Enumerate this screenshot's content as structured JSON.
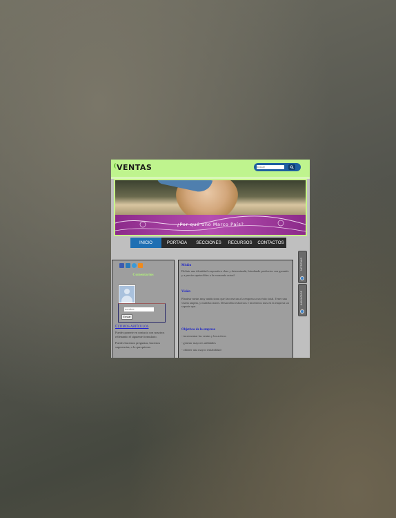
{
  "header": {
    "logo": "VENTAS",
    "search": {
      "placeholder": "buscar"
    }
  },
  "banner": {
    "caption": "¿Por qué uno Marco País?"
  },
  "nav": {
    "items": [
      "INICIO",
      "PORTADA",
      "SECCIONES",
      "RECURSOS",
      "CONTACTOS"
    ],
    "active_index": 0
  },
  "sidebar": {
    "social_icons": [
      "facebook-icon",
      "linkedin-icon",
      "twitter-icon",
      "rss-icon"
    ],
    "title": "Comentarios",
    "form": {
      "input_value": "nombre",
      "button_label": "Enviar"
    },
    "link": "ÚLTIMOS ARTÍCULOS",
    "text1": "Puedes ponerte en contacto con nosotros rellenando el siguiente formulario.",
    "text2": "Puedes hacernos preguntas, hacernos sugerencias, o lo que quieras."
  },
  "content": {
    "mision_title": "Misión",
    "mision_text": "Definir una identidad corporativa clara y determinada, brindando productos con garantía y a precios apetecibles a la economía actual.",
    "vision_title": "Visión",
    "vision_text": "Plantear metas muy ambiciosas que favorezcan a la empresa a un éxito total. Tener una visión amplia, y multifacciones. Desarrollar esfuerzos e incentivos más en la empresa un soporte que.",
    "objetivos_title": "Objetivos de la empresa",
    "objetivos": [
      "- incrementar las ventas y los activos",
      "- generar mayores utilidades",
      "- obtener una mayor rentabilidad"
    ]
  },
  "side_tabs": [
    {
      "label": "NOTICIAS",
      "icon": "arrow-icon"
    },
    {
      "label": "ANUNCIOS",
      "icon": "arrow-icon"
    }
  ],
  "colors": {
    "header_green": "#bff48e",
    "nav_active": "#1f6fb3",
    "link_blue": "#1d24c8",
    "banner_purple": "#b54eb0"
  }
}
